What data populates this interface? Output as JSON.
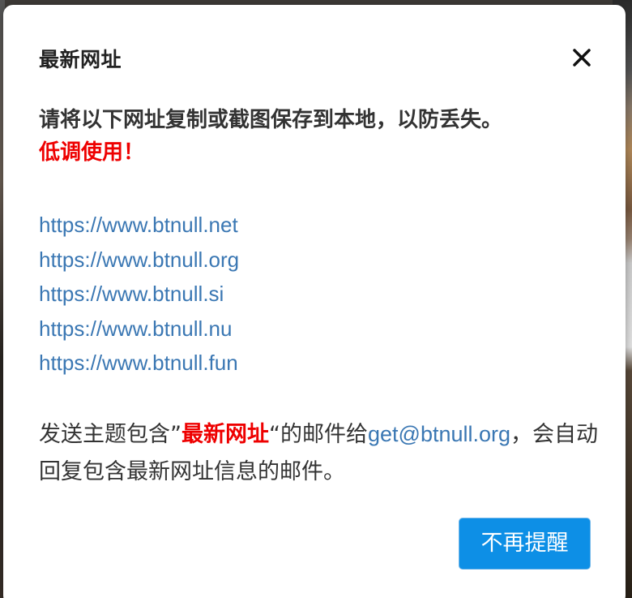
{
  "modal": {
    "title": "最新网址",
    "close_icon": "close-icon",
    "notice_main": "请将以下网址复制或截图保存到本地，以防丢失。",
    "notice_warn": "低调使用！",
    "links": [
      "https://www.btnull.net",
      "https://www.btnull.org",
      "https://www.btnull.si",
      "https://www.btnull.nu",
      "https://www.btnull.fun"
    ],
    "email_note": {
      "prefix": "发送主题包含”",
      "subject": "最新网址",
      "middle": "“的邮件给",
      "email": "get@btnull.org",
      "suffix": "，会自动回复包含最新网址信息的邮件。"
    },
    "dismiss_label": "不再提醒"
  },
  "colors": {
    "link": "#3a77b3",
    "warn": "#ee0000",
    "button": "#0d8fe6"
  }
}
